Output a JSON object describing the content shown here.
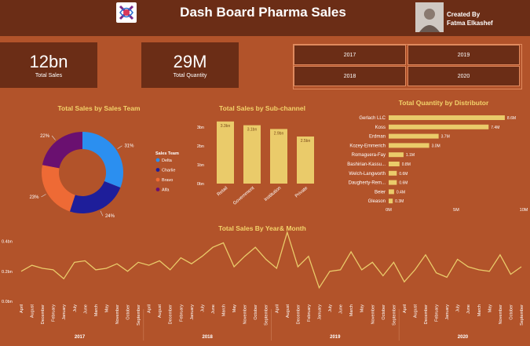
{
  "header": {
    "title": "Dash Board Pharma Sales",
    "created_by": "Created By",
    "author": "Fatma Elkashef"
  },
  "kpis": [
    {
      "value": "12bn",
      "label": "Total Sales"
    },
    {
      "value": "29M",
      "label": "Total Quantity"
    }
  ],
  "year_slicer": [
    "2017",
    "2019",
    "2018",
    "2020"
  ],
  "chart_data": [
    {
      "type": "pie",
      "title": "Total Sales by Sales Team",
      "legend_title": "Sales Team",
      "labels": [
        "Delta",
        "Charlie",
        "Bravo",
        "Alfa"
      ],
      "values": [
        31,
        24,
        23,
        22
      ],
      "display_labels": [
        "31%",
        "24%",
        "23%",
        "22%"
      ],
      "colors": [
        "#2b8ff0",
        "#1e1e9a",
        "#ee6a35",
        "#6a1070"
      ]
    },
    {
      "type": "bar",
      "title": "Total Sales by Sub-channel",
      "categories": [
        "Retail",
        "Government",
        "Institution",
        "Private"
      ],
      "values": [
        3.3,
        3.1,
        2.9,
        2.5
      ],
      "data_labels": [
        "3.3bn",
        "3.1bn",
        "2.9bn",
        "2.5bn"
      ],
      "ylim": [
        0,
        3.5
      ],
      "yticks": [
        0,
        1,
        2,
        3
      ],
      "ytick_labels": [
        "0bn",
        "1bn",
        "2bn",
        "3bn"
      ],
      "color": "#eacb6a"
    },
    {
      "type": "bar",
      "orientation": "horizontal",
      "title": "Total Quantity by Distributor",
      "categories": [
        "Gerlach LLC",
        "Koss",
        "Erdman",
        "Kozey-Emmerich",
        "Romaguera-Fay",
        "Bashirian-Kassu...",
        "Welch-Langworth",
        "Daugherty-Rem...",
        "Beier",
        "Gleason"
      ],
      "values": [
        8.6,
        7.4,
        3.7,
        3.0,
        1.1,
        0.8,
        0.6,
        0.6,
        0.4,
        0.3
      ],
      "data_labels": [
        "8.6M",
        "7.4M",
        "3.7M",
        "3.0M",
        "1.1M",
        "0.8M",
        "0.6M",
        "0.6M",
        "0.4M",
        "0.3M"
      ],
      "xlim": [
        0,
        10
      ],
      "xticks": [
        0,
        5,
        10
      ],
      "xtick_labels": [
        "0M",
        "5M",
        "10M"
      ],
      "color": "#eacb6a"
    },
    {
      "type": "line",
      "title": "Total Sales By Year& Month",
      "ylim": [
        0,
        0.45
      ],
      "yticks": [
        0,
        0.2,
        0.4
      ],
      "ytick_labels": [
        "0.0bn",
        "0.2bn",
        "0.4bn"
      ],
      "x_months": [
        "April",
        "August",
        "December",
        "February",
        "January",
        "July",
        "June",
        "March",
        "May",
        "November",
        "October",
        "September",
        "April",
        "August",
        "December",
        "February",
        "January",
        "July",
        "June",
        "March",
        "May",
        "November",
        "October",
        "September",
        "April",
        "August",
        "December",
        "February",
        "January",
        "July",
        "June",
        "March",
        "May",
        "November",
        "October",
        "September",
        "April",
        "August",
        "December",
        "February",
        "January",
        "July",
        "June",
        "March",
        "May",
        "November",
        "October",
        "September"
      ],
      "years": [
        "2017",
        "2018",
        "2019",
        "2020"
      ],
      "values": [
        0.2,
        0.24,
        0.22,
        0.21,
        0.15,
        0.26,
        0.27,
        0.21,
        0.22,
        0.25,
        0.2,
        0.26,
        0.24,
        0.27,
        0.21,
        0.29,
        0.25,
        0.3,
        0.36,
        0.39,
        0.23,
        0.3,
        0.36,
        0.28,
        0.22,
        0.46,
        0.23,
        0.3,
        0.09,
        0.2,
        0.21,
        0.33,
        0.21,
        0.26,
        0.17,
        0.26,
        0.13,
        0.21,
        0.31,
        0.19,
        0.16,
        0.28,
        0.23,
        0.21,
        0.2,
        0.31,
        0.18,
        0.23
      ],
      "color": "#eacb6a"
    }
  ]
}
